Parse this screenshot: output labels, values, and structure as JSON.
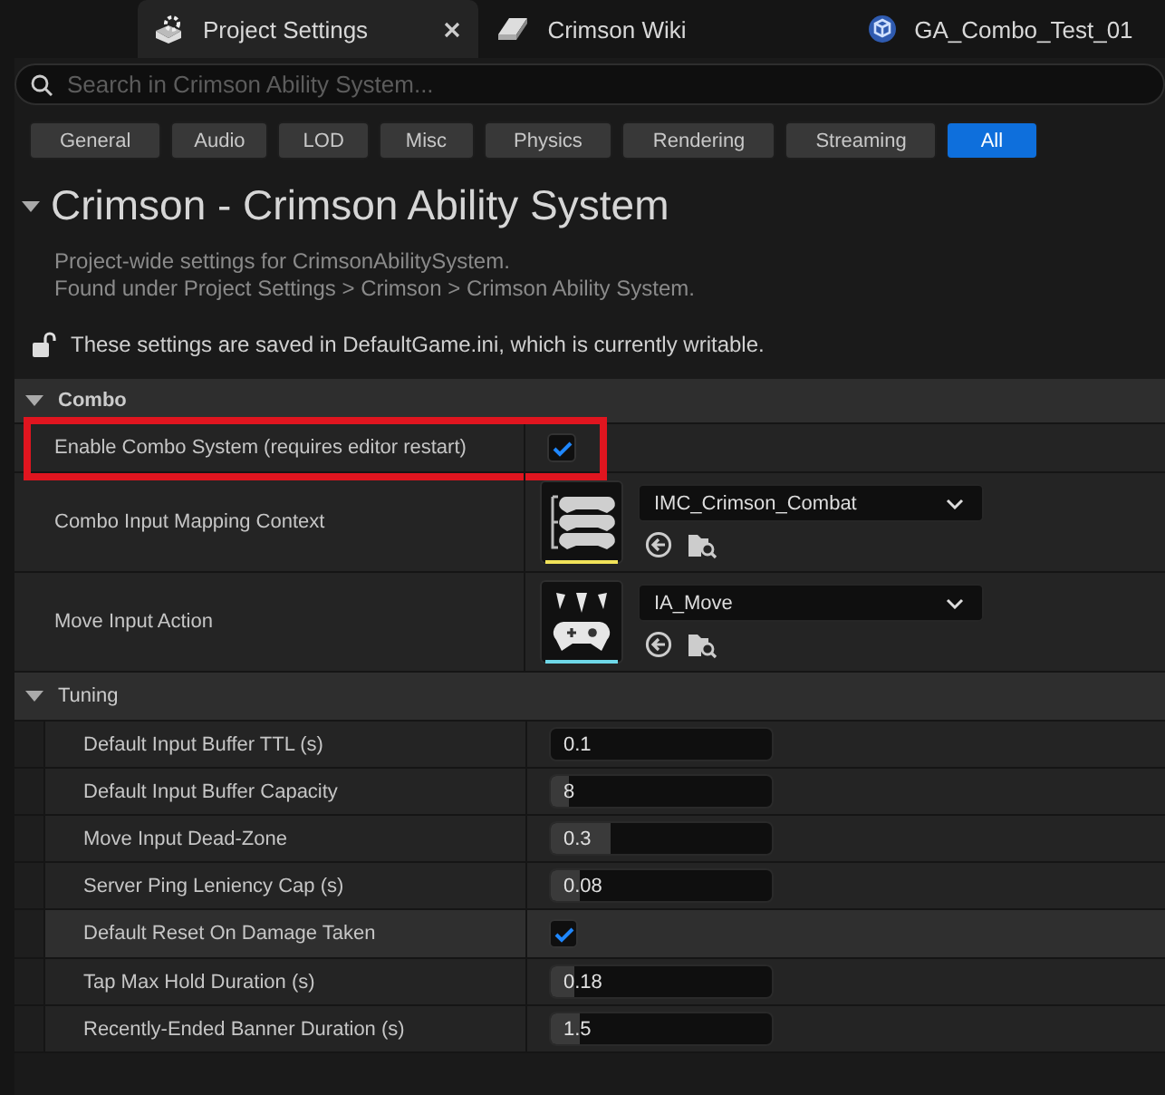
{
  "tabs": [
    {
      "label": "Project Settings",
      "selected": true,
      "kind": "settings"
    },
    {
      "label": "Crimson Wiki",
      "selected": false,
      "kind": "book"
    },
    {
      "label": "GA_Combo_Test_01",
      "selected": false,
      "kind": "blueprint"
    }
  ],
  "search": {
    "placeholder": "Search in Crimson Ability System..."
  },
  "filters": [
    {
      "label": "General",
      "selected": false
    },
    {
      "label": "Audio",
      "selected": false
    },
    {
      "label": "LOD",
      "selected": false
    },
    {
      "label": "Misc",
      "selected": false
    },
    {
      "label": "Physics",
      "selected": false
    },
    {
      "label": "Rendering",
      "selected": false
    },
    {
      "label": "Streaming",
      "selected": false
    },
    {
      "label": "All",
      "selected": true
    }
  ],
  "section": {
    "title": "Crimson - Crimson Ability System",
    "expanded": true,
    "description": [
      "Project-wide settings for CrimsonAbilitySystem.",
      "Found under Project Settings > Crimson > Crimson Ability System."
    ],
    "config_note": "These settings are saved in DefaultGame.ini, which is currently writable."
  },
  "categories": [
    {
      "title": "Combo",
      "expanded": true,
      "rows": [
        {
          "kind": "checkbox",
          "label": "Enable Combo System (requires editor restart)",
          "checked": true,
          "highlighted": true
        },
        {
          "kind": "mapping_asset",
          "label": "Combo Input Mapping Context",
          "value": "IMC_Crimson_Combat",
          "color": "#f2e35a"
        },
        {
          "kind": "action_asset",
          "label": "Move Input Action",
          "value": "IA_Move",
          "color": "#6fd8e8"
        }
      ]
    },
    {
      "title": "Tuning",
      "expanded": true,
      "rows": [
        {
          "kind": "number",
          "label": "Default Input Buffer TTL (s)",
          "value": "0.1",
          "level": 0
        },
        {
          "kind": "number",
          "label": "Default Input Buffer Capacity",
          "value": "8",
          "level": 0.08
        },
        {
          "kind": "number",
          "label": "Move Input Dead-Zone",
          "value": "0.3",
          "level": 0.27
        },
        {
          "kind": "number",
          "label": "Server Ping Leniency Cap (s)",
          "value": "0.08",
          "level": 0.13
        },
        {
          "kind": "checkbox",
          "label": "Default Reset On Damage Taken",
          "checked": true,
          "hovered": true
        },
        {
          "kind": "number",
          "label": "Tap Max Hold Duration (s)",
          "value": "0.18",
          "level": 0.11
        },
        {
          "kind": "number",
          "label": "Recently-Ended Banner Duration (s)",
          "value": "1.5",
          "level": 0.13
        }
      ]
    }
  ]
}
